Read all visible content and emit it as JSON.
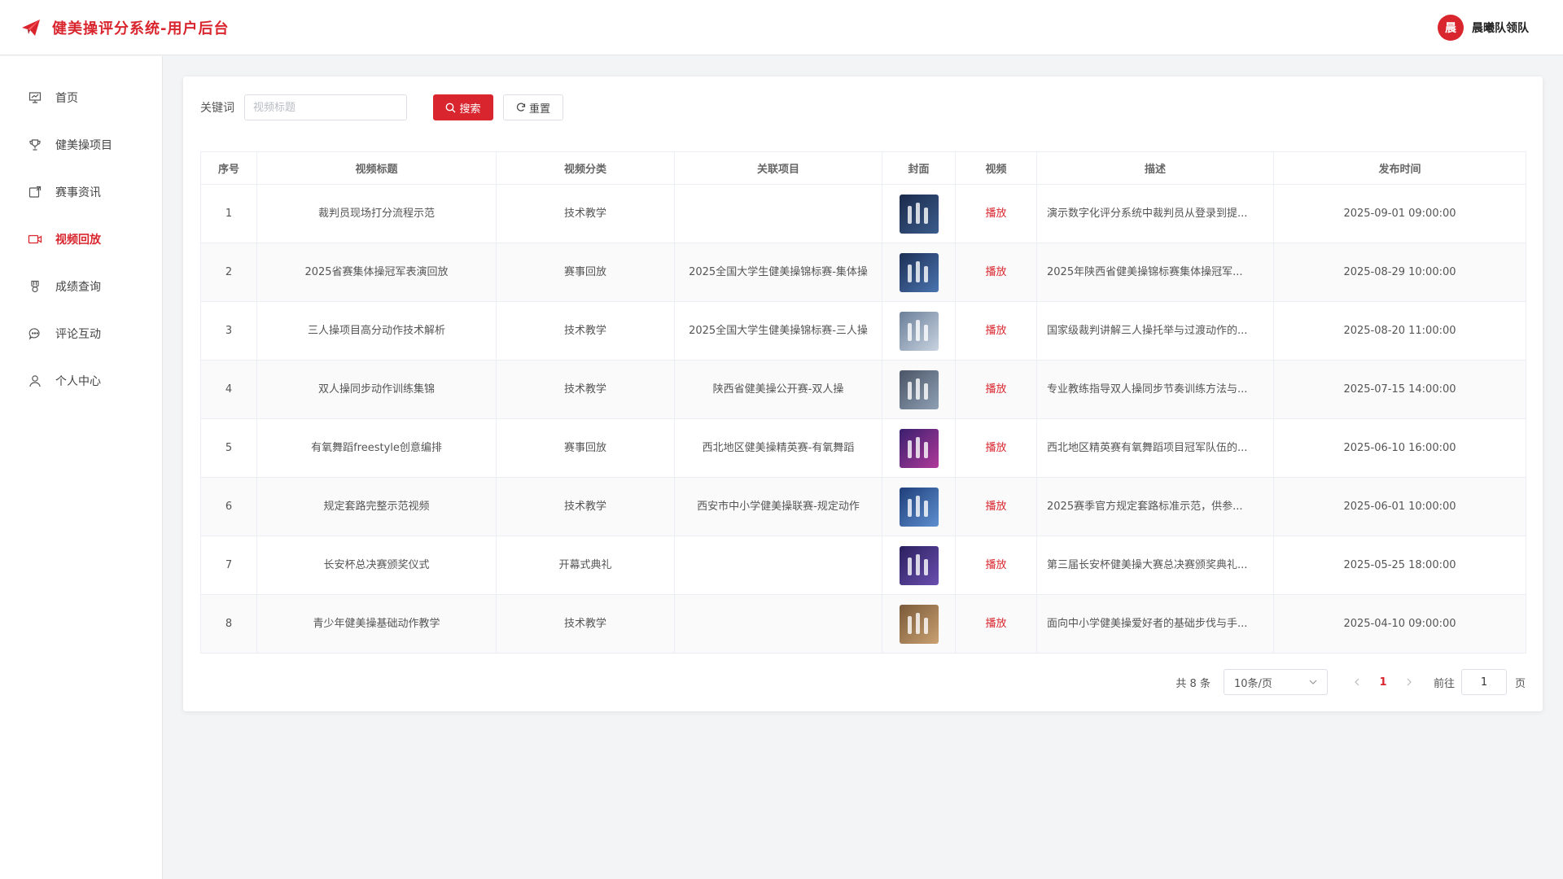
{
  "header": {
    "title": "健美操评分系统-用户后台",
    "user_initial": "晨",
    "user_name": "晨曦队领队"
  },
  "sidebar": {
    "items": [
      {
        "label": "首页",
        "icon": "presentation-icon",
        "active": false
      },
      {
        "label": "健美操项目",
        "icon": "trophy-icon",
        "active": false
      },
      {
        "label": "赛事资讯",
        "icon": "news-icon",
        "active": false
      },
      {
        "label": "视频回放",
        "icon": "video-camera-icon",
        "active": true
      },
      {
        "label": "成绩查询",
        "icon": "medal-icon",
        "active": false
      },
      {
        "label": "评论互动",
        "icon": "chat-icon",
        "active": false
      },
      {
        "label": "个人中心",
        "icon": "user-icon",
        "active": false
      }
    ]
  },
  "search": {
    "label": "关键词",
    "placeholder": "视频标题",
    "value": "",
    "search_button": "搜索",
    "reset_button": "重置"
  },
  "table": {
    "columns": [
      "序号",
      "视频标题",
      "视频分类",
      "关联项目",
      "封面",
      "视频",
      "描述",
      "发布时间"
    ],
    "play_label": "播放",
    "rows": [
      {
        "index": "1",
        "title": "裁判员现场打分流程示范",
        "category": "技术教学",
        "project": "",
        "desc": "演示数字化评分系统中裁判员从登录到提...",
        "time": "2025-09-01 09:00:00",
        "cover": [
          "#1a2a4a",
          "#3b5c8c"
        ]
      },
      {
        "index": "2",
        "title": "2025省赛集体操冠军表演回放",
        "category": "赛事回放",
        "project": "2025全国大学生健美操锦标赛-集体操",
        "desc": "2025年陕西省健美操锦标赛集体操冠军...",
        "time": "2025-08-29 10:00:00",
        "cover": [
          "#1d2f55",
          "#4a74b0"
        ]
      },
      {
        "index": "3",
        "title": "三人操项目高分动作技术解析",
        "category": "技术教学",
        "project": "2025全国大学生健美操锦标赛-三人操",
        "desc": "国家级裁判讲解三人操托举与过渡动作的...",
        "time": "2025-08-20 11:00:00",
        "cover": [
          "#6b7f99",
          "#c8d3e0"
        ]
      },
      {
        "index": "4",
        "title": "双人操同步动作训练集锦",
        "category": "技术教学",
        "project": "陕西省健美操公开赛-双人操",
        "desc": "专业教练指导双人操同步节奏训练方法与...",
        "time": "2025-07-15 14:00:00",
        "cover": [
          "#4a5566",
          "#8fa0b5"
        ]
      },
      {
        "index": "5",
        "title": "有氧舞蹈freestyle创意编排",
        "category": "赛事回放",
        "project": "西北地区健美操精英赛-有氧舞蹈",
        "desc": "西北地区精英赛有氧舞蹈项目冠军队伍的...",
        "time": "2025-06-10 16:00:00",
        "cover": [
          "#3a1f6e",
          "#b03a9a"
        ]
      },
      {
        "index": "6",
        "title": "规定套路完整示范视频",
        "category": "技术教学",
        "project": "西安市中小学健美操联赛-规定动作",
        "desc": "2025赛季官方规定套路标准示范，供参...",
        "time": "2025-06-01 10:00:00",
        "cover": [
          "#1e3f7a",
          "#5f8fd0"
        ]
      },
      {
        "index": "7",
        "title": "长安杯总决赛颁奖仪式",
        "category": "开幕式典礼",
        "project": "",
        "desc": "第三届长安杯健美操大赛总决赛颁奖典礼...",
        "time": "2025-05-25 18:00:00",
        "cover": [
          "#2b1f5e",
          "#6a4fb0"
        ]
      },
      {
        "index": "8",
        "title": "青少年健美操基础动作教学",
        "category": "技术教学",
        "project": "",
        "desc": "面向中小学健美操爱好者的基础步伐与手...",
        "time": "2025-04-10 09:00:00",
        "cover": [
          "#7a5a3a",
          "#c9a070"
        ]
      }
    ]
  },
  "pagination": {
    "total": "共 8 条",
    "page_size": "10条/页",
    "current_page": "1",
    "goto_label": "前往",
    "goto_value": "1",
    "goto_suffix": "页"
  },
  "colors": {
    "accent": "#d9262e"
  }
}
